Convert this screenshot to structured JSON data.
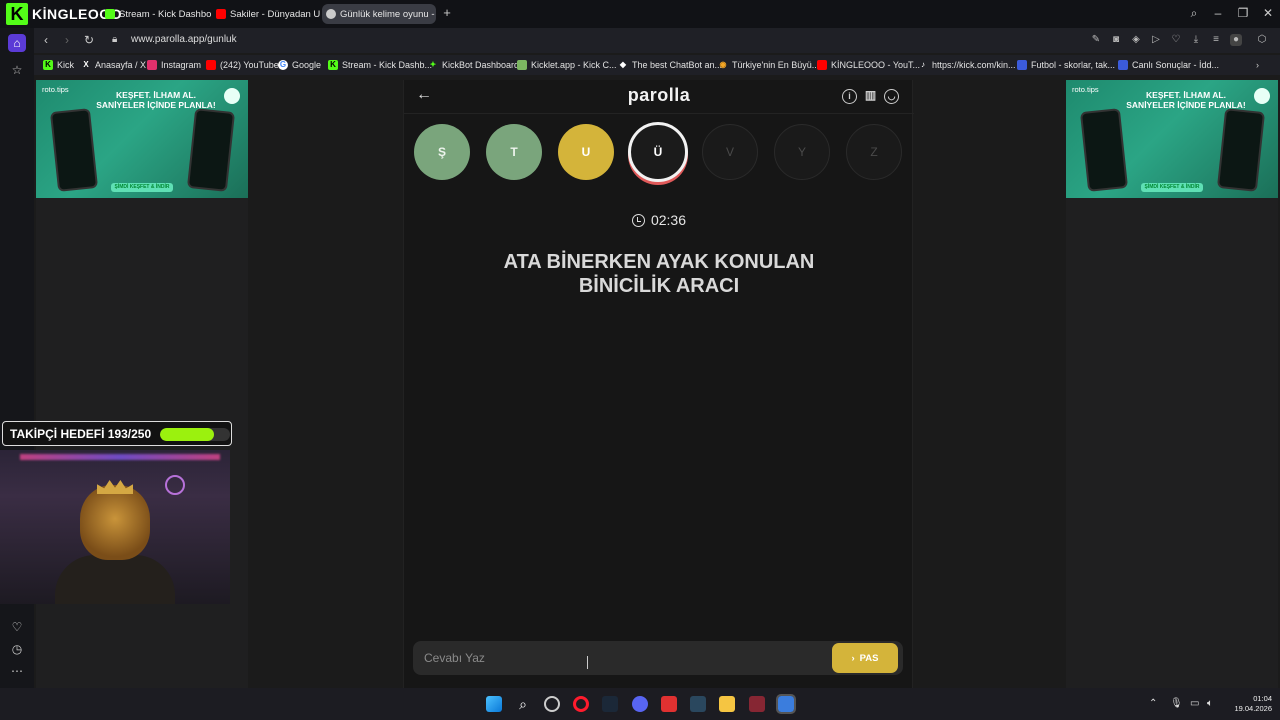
{
  "browser": {
    "brand": "KİNGLEOOO",
    "tabs": [
      {
        "label": "Stream - Kick Dashboard",
        "icon": "kick-icon",
        "color": "#53fc18"
      },
      {
        "label": "Sakiler - Dünyadan Uzak (",
        "icon": "youtube-icon",
        "color": "#ff0000"
      },
      {
        "label": "Günlük kelime oyunu - pa",
        "icon": "parolla-icon",
        "color": "#cccccc",
        "active": true
      }
    ],
    "url": "www.parolla.app/gunluk",
    "bookmarks": [
      {
        "label": "Kick",
        "color": "#53fc18"
      },
      {
        "label": "Anasayfa / X",
        "color": "#ffffff"
      },
      {
        "label": "Instagram",
        "color": "#e1306c"
      },
      {
        "label": "(242) YouTube",
        "color": "#ff0000"
      },
      {
        "label": "Google",
        "color": "#4285f4"
      },
      {
        "label": "Stream - Kick Dashb...",
        "color": "#53fc18"
      },
      {
        "label": "KickBot Dashboard",
        "color": "#53fc18"
      },
      {
        "label": "Kicklet.app - Kick C...",
        "color": "#7bb661"
      },
      {
        "label": "The best ChatBot an...",
        "color": "#ffffff"
      },
      {
        "label": "Türkiye'nin En Büyü...",
        "color": "#f5a623"
      },
      {
        "label": "KİNGLEOOO - YouT...",
        "color": "#ff0000"
      },
      {
        "label": "https://kick.com/kin...",
        "color": "#ffffff"
      },
      {
        "label": "Futbol - skorlar, tak...",
        "color": "#3b5bdb"
      },
      {
        "label": "Canlı Sonuçlar - İdd...",
        "color": "#3b5bdb"
      }
    ]
  },
  "ads": {
    "brand": "roto.tips",
    "headline_1": "KEŞFET. İLHAM AL.",
    "headline_2": "SANİYELER İÇİNDE PLANLA!",
    "cta": "ŞİMDİ KEŞFET & İNDİR"
  },
  "game": {
    "logo": "parolla",
    "letters": [
      {
        "letter": "Ş",
        "state": "correct"
      },
      {
        "letter": "T",
        "state": "correct"
      },
      {
        "letter": "U",
        "state": "pass"
      },
      {
        "letter": "Ü",
        "state": "current"
      },
      {
        "letter": "V",
        "state": "empty"
      },
      {
        "letter": "Y",
        "state": "empty"
      },
      {
        "letter": "Z",
        "state": "empty"
      }
    ],
    "timer": "02:36",
    "question_line1": "ATA BİNERKEN AYAK KONULAN",
    "question_line2": "BİNİCİLİK ARACI",
    "answer_placeholder": "Cevabı Yaz",
    "pass_label": "PAS",
    "colors": {
      "correct": "#7aa57c",
      "pass": "#d4b43a",
      "current_ring": "#e05a5a"
    }
  },
  "overlay": {
    "goal_label": "TAKİPÇİ HEDEFİ 193/250",
    "goal_progress": 0.772
  },
  "system": {
    "time": "01:04",
    "date": "19.04.2026"
  }
}
